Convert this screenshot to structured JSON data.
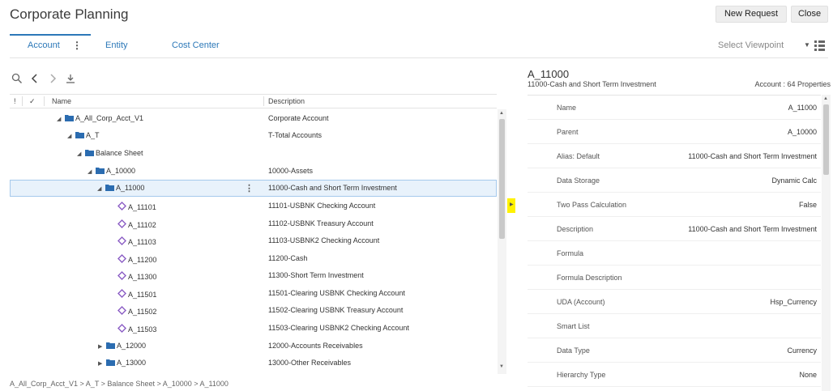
{
  "header": {
    "title": "Corporate Planning",
    "new_request_label": "New Request",
    "close_label": "Close"
  },
  "tabs": [
    {
      "label": "Account",
      "active": true
    },
    {
      "label": "Entity",
      "active": false
    },
    {
      "label": "Cost Center",
      "active": false
    }
  ],
  "viewpoint": {
    "placeholder": "Select Viewpoint"
  },
  "toolbar": {
    "icons": [
      "search-icon",
      "back-icon",
      "forward-icon",
      "download-icon"
    ]
  },
  "grid": {
    "columns": {
      "flag": "!",
      "check": "✓",
      "name": "Name",
      "description": "Description"
    },
    "rows": [
      {
        "name": "A_All_Corp_Acct_V1",
        "description": "Corporate Account",
        "icon": "folder-icon",
        "toggle": "expanded"
      },
      {
        "name": "A_T",
        "description": "T-Total Accounts",
        "icon": "folder-icon",
        "toggle": "expanded"
      },
      {
        "name": "Balance Sheet",
        "description": "",
        "icon": "folder-icon",
        "toggle": "expanded"
      },
      {
        "name": "A_10000",
        "description": "10000-Assets",
        "icon": "folder-icon",
        "toggle": "expanded"
      },
      {
        "name": "A_11000",
        "description": "11000-Cash and Short Term Investment",
        "icon": "folder-icon",
        "toggle": "expanded",
        "selected": true
      },
      {
        "name": "A_11101",
        "description": "11101-USBNK Checking Account",
        "icon": "member-icon"
      },
      {
        "name": "A_11102",
        "description": "11102-USBNK Treasury Account",
        "icon": "member-icon"
      },
      {
        "name": "A_11103",
        "description": "11103-USBNK2 Checking Account",
        "icon": "member-icon"
      },
      {
        "name": "A_11200",
        "description": "11200-Cash",
        "icon": "member-icon"
      },
      {
        "name": "A_11300",
        "description": "11300-Short Term Investment",
        "icon": "member-icon"
      },
      {
        "name": "A_11501",
        "description": "11501-Clearing USBNK Checking Account",
        "icon": "member-icon"
      },
      {
        "name": "A_11502",
        "description": "11502-Clearing USBNK Treasury Account",
        "icon": "member-icon"
      },
      {
        "name": "A_11503",
        "description": "11503-Clearing USBNK2 Checking Account",
        "icon": "member-icon"
      },
      {
        "name": "A_12000",
        "description": "12000-Accounts Receivables",
        "icon": "folder-icon",
        "toggle": "collapsed"
      },
      {
        "name": "A_13000",
        "description": "13000-Other Receivables",
        "icon": "folder-icon",
        "toggle": "collapsed"
      }
    ]
  },
  "breadcrumb": "A_All_Corp_Acct_V1 > A_T > Balance Sheet > A_10000 > A_11000",
  "properties": {
    "title": "A_11000",
    "subtitle": "11000-Cash and Short Term Investment",
    "count": "Account : 64 Properties",
    "items": [
      {
        "label": "Name",
        "value": "A_11000"
      },
      {
        "label": "Parent",
        "value": "A_10000"
      },
      {
        "label": "Alias: Default",
        "value": "11000-Cash and Short Term Investment"
      },
      {
        "label": "Data Storage",
        "value": "Dynamic Calc"
      },
      {
        "label": "Two Pass Calculation",
        "value": "False"
      },
      {
        "label": "Description",
        "value": "11000-Cash and Short Term Investment"
      },
      {
        "label": "Formula",
        "value": ""
      },
      {
        "label": "Formula Description",
        "value": ""
      },
      {
        "label": "UDA (Account)",
        "value": "Hsp_Currency"
      },
      {
        "label": "Smart List",
        "value": ""
      },
      {
        "label": "Data Type",
        "value": "Currency"
      },
      {
        "label": "Hierarchy Type",
        "value": "None"
      }
    ]
  },
  "colors": {
    "accent": "#2c78b8",
    "folder": "#2b6cb0",
    "member": "#8a5cc4",
    "selection": "#e8f2fb",
    "splitter": "#fff200"
  }
}
